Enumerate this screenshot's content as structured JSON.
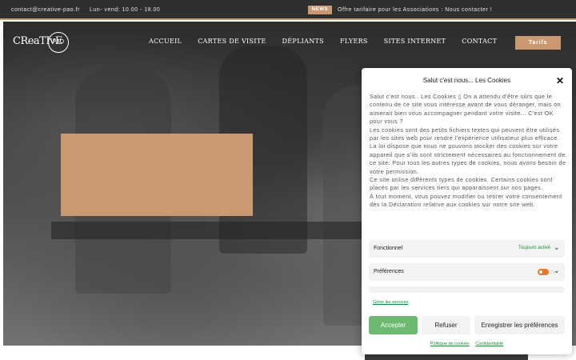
{
  "topbar": {
    "contact_email": "contact@creative-pao.fr",
    "hours": "Lun- vend: 10.00 - 18.00",
    "news_badge": "NEWS",
    "news_text": "Offre tarifaire pour les Associations : Nous contacter !"
  },
  "header": {
    "logo_text": "CReaTIvE",
    "logo_circle_text": "PAO",
    "nav_items": [
      "ACCUEIL",
      "CARTES DE VISITE",
      "DÉPLIANTS",
      "FLYERS",
      "SITES INTERNET",
      "CONTACT"
    ],
    "cta_label": "Tarifs"
  },
  "cookie_banner": {
    "title": "Salut c'est nous... Les Cookies",
    "paragraphs": [
      "Salut c'est nous.. Les Cookies ▯ On a attendu d'être sûrs que le contenu de ce site vous intéresse avant de vous déranger, mais on aimerait bien vous accompagner pendant votre visite... C'est OK pour vous ?",
      "Les cookies sont des petits fichiers textes qui peuvent être utilisés par les sites web pour rendre l'expérience utilisateur plus efficace.",
      "La loi dispose que nous ne pouvons stocker des cookies sur votre appareil que s'ils sont strictement nécessaires au fonctionnement de ce site. Pour tous les autres types de cookies, nous avons besoin de votre permission.",
      "Ce site utilise différents types de cookies. Certains cookies sont placés par les services tiers qui apparaissent sur nos pages.",
      "À tout moment, vous pouvez modifier ou retirer votre consentement dès la Déclaration relative aux cookies sur notre site web."
    ],
    "categories": [
      {
        "label": "Fonctionnel",
        "status": "Toujours activé"
      },
      {
        "label": "Préférences",
        "status": ""
      }
    ],
    "manage_link": "Gérer les services",
    "buttons": {
      "accept": "Accepter",
      "refuse": "Refuser",
      "save": "Enregistrer les préférences"
    },
    "links": {
      "cookie_policy": "Politique de cookies",
      "privacy": "Confidentialité"
    },
    "toggle_color": "#e8772e",
    "accent_color": "#6cb96f"
  },
  "colors": {
    "brand_tan": "#c99a72",
    "topbar_bg": "#2f2f2f",
    "link_green": "#1e8a3c"
  }
}
